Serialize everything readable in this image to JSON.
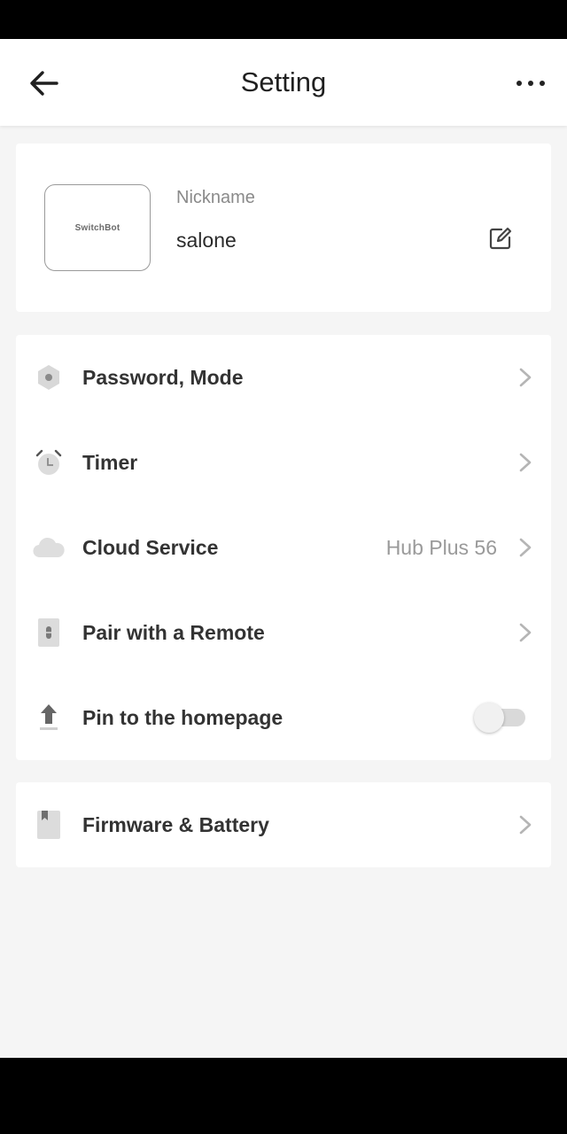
{
  "header": {
    "title": "Setting",
    "back_icon": "arrow-left-icon",
    "more_icon": "more-horizontal-icon"
  },
  "device": {
    "brand": "SwitchBot",
    "nickname_label": "Nickname",
    "nickname_value": "salone",
    "edit_icon": "edit-icon"
  },
  "menu": {
    "items": [
      {
        "label": "Password, Mode",
        "icon": "hexagon-lock-icon",
        "value": "",
        "control": "chevron"
      },
      {
        "label": "Timer",
        "icon": "alarm-clock-icon",
        "value": "",
        "control": "chevron"
      },
      {
        "label": "Cloud Service",
        "icon": "cloud-icon",
        "value": "Hub Plus 56",
        "control": "chevron"
      },
      {
        "label": "Pair with a Remote",
        "icon": "remote-icon",
        "value": "",
        "control": "chevron"
      },
      {
        "label": "Pin to the homepage",
        "icon": "pin-upload-icon",
        "value": "",
        "control": "toggle",
        "toggle_on": false
      }
    ]
  },
  "firmware": {
    "label": "Firmware & Battery",
    "icon": "bookmark-document-icon"
  },
  "colors": {
    "background": "#f5f5f5",
    "card": "#ffffff",
    "text_primary": "#333333",
    "text_secondary": "#9a9a9a",
    "icon_gray": "#d6d6d6"
  }
}
